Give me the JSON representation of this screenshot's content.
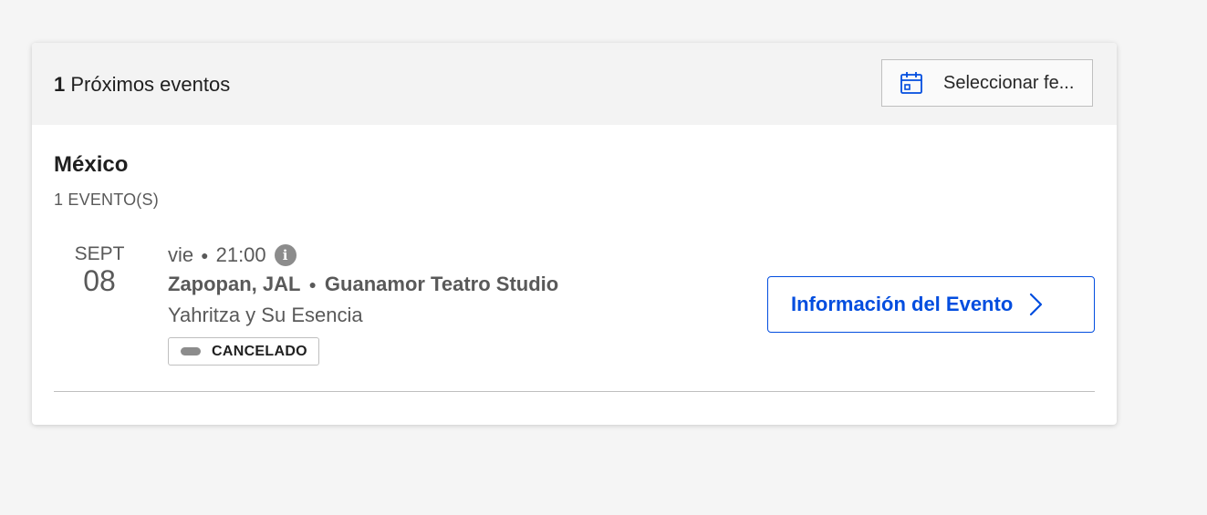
{
  "header": {
    "count": "1",
    "title": "Próximos eventos",
    "date_button_label": "Seleccionar fe...",
    "date_button_icon": "calendar-icon"
  },
  "group": {
    "region": "México",
    "event_count": "1 EVENTO(S)"
  },
  "event": {
    "month": "SEPT",
    "day": "08",
    "weekday": "vie",
    "time": "21:00",
    "city": "Zapopan, JAL",
    "venue": "Guanamor Teatro Studio",
    "artist": "Yahritza y Su Esencia",
    "status": "CANCELADO",
    "info_icon": "info-icon",
    "button_label": "Información del Evento",
    "button_icon": "chevron-right-icon"
  },
  "colors": {
    "accent": "#024ddf",
    "muted_text": "#595959",
    "header_bg": "#f3f3f3",
    "status_gray": "#8c8c8c"
  }
}
